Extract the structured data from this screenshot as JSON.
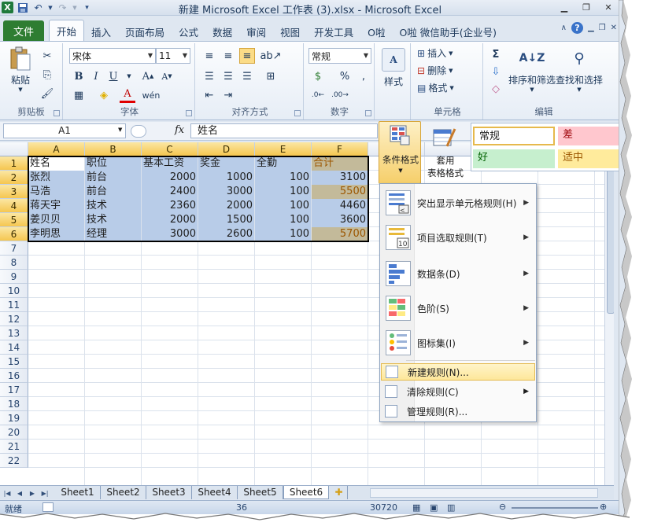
{
  "window": {
    "title": "新建 Microsoft Excel 工作表 (3).xlsx - Microsoft Excel"
  },
  "tabs": [
    "开始",
    "插入",
    "页面布局",
    "公式",
    "数据",
    "审阅",
    "视图",
    "开发工具",
    "O啦",
    "O啦 微信助手(企业号)"
  ],
  "file_tab": "文件",
  "active_tab": "开始",
  "ribbon": {
    "clipboard": {
      "label": "剪贴板",
      "paste": "粘贴"
    },
    "font": {
      "label": "字体",
      "font_name": "宋体",
      "font_size": "11",
      "bold": "B",
      "italic": "I",
      "underline": "U"
    },
    "alignment": {
      "label": "对齐方式"
    },
    "number": {
      "label": "数字",
      "format": "常规",
      "percent": "%"
    },
    "styles": {
      "label": "样式"
    },
    "cells": {
      "label": "单元格",
      "insert": "插入",
      "delete": "删除",
      "format": "格式"
    },
    "editing": {
      "label": "编辑",
      "sort_filter": "排序和筛选",
      "find_select": "查找和选择",
      "sum_icon": "Σ"
    }
  },
  "formula_bar": {
    "name_box": "A1",
    "fx": "fx",
    "value": "姓名"
  },
  "columns": [
    "A",
    "B",
    "C",
    "D",
    "E",
    "F"
  ],
  "rows": [
    "1",
    "2",
    "3",
    "4",
    "5",
    "6",
    "7",
    "8",
    "9",
    "10",
    "11",
    "12",
    "13",
    "14",
    "15",
    "16",
    "17",
    "18",
    "19",
    "20",
    "21",
    "22"
  ],
  "table": {
    "headers": [
      "姓名",
      "职位",
      "基本工资",
      "奖金",
      "全勤",
      "合计"
    ],
    "data": [
      [
        "张烈",
        "前台",
        "2000",
        "1000",
        "100",
        "3100"
      ],
      [
        "马浩",
        "前台",
        "2400",
        "3000",
        "100",
        "5500"
      ],
      [
        "蒋天宇",
        "技术",
        "2360",
        "2000",
        "100",
        "4460"
      ],
      [
        "姜贝贝",
        "技术",
        "2000",
        "1500",
        "100",
        "3600"
      ],
      [
        "李明思",
        "经理",
        "3000",
        "2600",
        "100",
        "5700"
      ]
    ]
  },
  "styles_gallery": {
    "cond_format": "条件格式",
    "table_format_1": "套用",
    "table_format_2": "表格格式",
    "cell_styles": [
      "常规",
      "差",
      "好",
      "适中"
    ],
    "colors": {
      "normal_border": "#e6b94c",
      "bad_bg": "#ffc7ce",
      "bad_text": "#9c0006",
      "good_bg": "#c6efce",
      "good_text": "#006100",
      "neutral_bg": "#ffeb9c",
      "neutral_text": "#9c5700"
    }
  },
  "cf_menu": {
    "items": [
      {
        "label": "突出显示单元格规则(H)",
        "icon": "highlight-cells-rules-icon"
      },
      {
        "label": "项目选取规则(T)",
        "icon": "top-bottom-rules-icon"
      },
      {
        "label": "数据条(D)",
        "icon": "data-bars-icon"
      },
      {
        "label": "色阶(S)",
        "icon": "color-scales-icon"
      },
      {
        "label": "图标集(I)",
        "icon": "icon-sets-icon"
      }
    ],
    "small_items": [
      {
        "label": "新建规则(N)...",
        "icon": "new-rule-icon"
      },
      {
        "label": "清除规则(C)",
        "icon": "clear-rules-icon"
      },
      {
        "label": "管理规则(R)...",
        "icon": "manage-rules-icon"
      }
    ]
  },
  "sheets": [
    "Sheet1",
    "Sheet2",
    "Sheet3",
    "Sheet4",
    "Sheet5",
    "Sheet6"
  ],
  "active_sheet": "Sheet6",
  "status": {
    "ready": "就绪",
    "count": "36",
    "sum": "30720"
  }
}
